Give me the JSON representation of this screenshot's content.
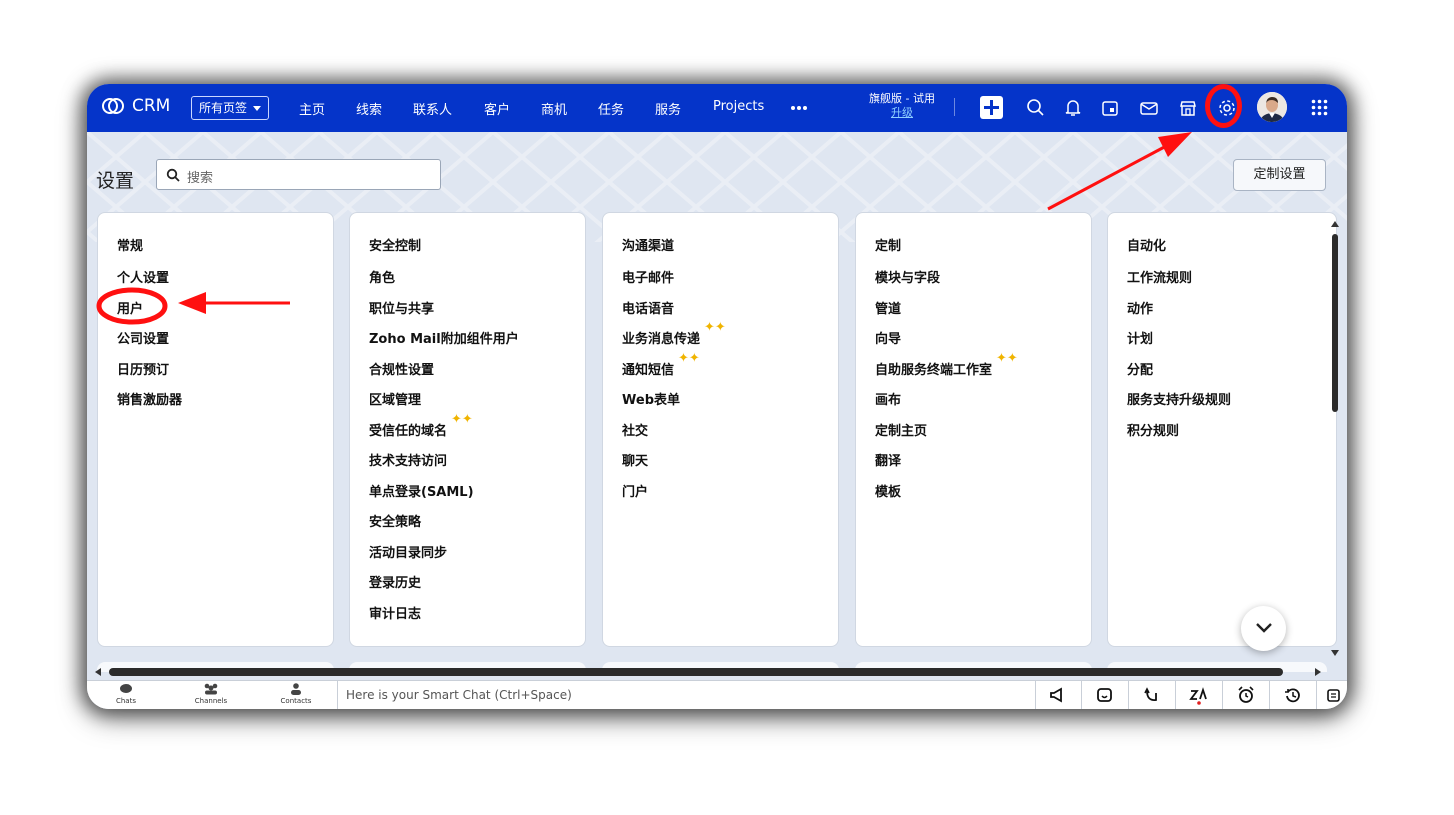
{
  "app": {
    "brand": "CRM",
    "tabs_button": "所有页签"
  },
  "nav": [
    "主页",
    "线索",
    "联系人",
    "客户",
    "商机",
    "任务",
    "服务",
    "Projects"
  ],
  "plan": {
    "edition": "旗舰版 - 试用",
    "upgrade": "升级"
  },
  "icons": [
    "crm-logo-icon",
    "plus-icon",
    "search-icon",
    "bell-icon",
    "calendar-icon",
    "mail-icon",
    "store-icon",
    "gear-icon",
    "app-grid-icon"
  ],
  "settings": {
    "title": "设置",
    "search_placeholder": "搜索",
    "customize_button": "定制设置"
  },
  "sections": [
    {
      "title": "常规",
      "items": [
        {
          "label": "个人设置"
        },
        {
          "label": "用户"
        },
        {
          "label": "公司设置"
        },
        {
          "label": "日历预订"
        },
        {
          "label": "销售激励器"
        }
      ]
    },
    {
      "title": "安全控制",
      "items": [
        {
          "label": "角色"
        },
        {
          "label": "职位与共享"
        },
        {
          "label": "Zoho Mail附加组件用户"
        },
        {
          "label": "合规性设置"
        },
        {
          "label": "区域管理"
        },
        {
          "label": "受信任的域名"
        },
        {
          "label": "技术支持访问"
        },
        {
          "label": "单点登录(SAML)"
        },
        {
          "label": "安全策略"
        },
        {
          "label": "活动目录同步"
        },
        {
          "label": "登录历史"
        },
        {
          "label": "审计日志"
        }
      ]
    },
    {
      "title": "沟通渠道",
      "items": [
        {
          "label": "电子邮件"
        },
        {
          "label": "电话语音"
        },
        {
          "label": "业务消息传递"
        },
        {
          "label": "通知短信"
        },
        {
          "label": "Web表单"
        },
        {
          "label": "社交"
        },
        {
          "label": "聊天"
        },
        {
          "label": "门户"
        }
      ]
    },
    {
      "title": "定制",
      "items": [
        {
          "label": "模块与字段"
        },
        {
          "label": "管道"
        },
        {
          "label": "向导"
        },
        {
          "label": "自助服务终端工作室"
        },
        {
          "label": "画布"
        },
        {
          "label": "定制主页"
        },
        {
          "label": "翻译"
        },
        {
          "label": "模板"
        }
      ]
    },
    {
      "title": "自动化",
      "items": [
        {
          "label": "工作流规则"
        },
        {
          "label": "动作"
        },
        {
          "label": "计划"
        },
        {
          "label": "分配"
        },
        {
          "label": "服务支持升级规则"
        },
        {
          "label": "积分规则"
        }
      ]
    }
  ],
  "bottombar": {
    "chats": "Chats",
    "channels": "Channels",
    "contacts": "Contacts",
    "smart_chat": "Here is your Smart Chat (Ctrl+Space)"
  },
  "colors": {
    "topbar": "#0534c9",
    "annotation": "#ff1010",
    "sparkle": "#f0b400"
  }
}
